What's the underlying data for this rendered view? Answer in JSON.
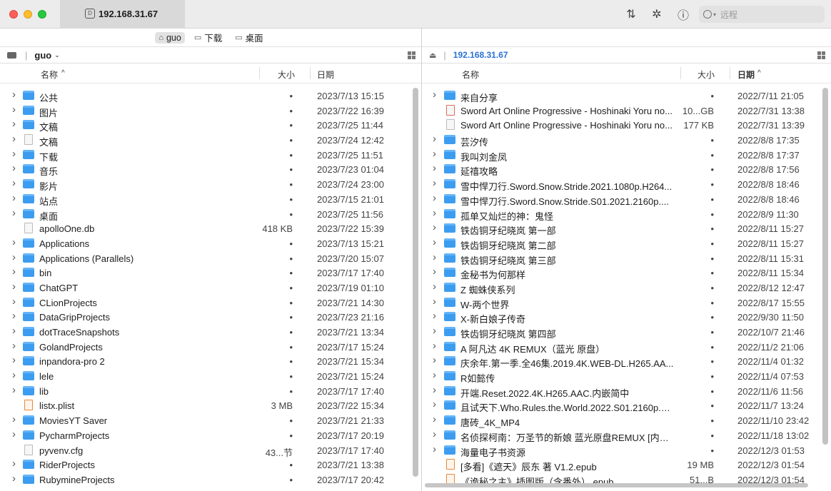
{
  "window": {
    "tab_title": "192.168.31.67"
  },
  "toolbar": {
    "sort_icon": "arrows-up-down-icon",
    "activity_icon": "pinwheel-icon",
    "info_icon": "info-icon",
    "search_placeholder": "远程"
  },
  "breadcrumbs": [
    {
      "label": "guo",
      "icon": "home-icon"
    },
    {
      "label": "下载",
      "icon": "folder-icon"
    },
    {
      "label": "桌面",
      "icon": "folder-icon"
    }
  ],
  "left": {
    "location": "guo",
    "columns": {
      "name": "名称",
      "size": "大小",
      "date": "日期"
    },
    "rows": [
      {
        "name": "公共",
        "size": "•",
        "date": "2023/7/13 15:15",
        "kind": "folder",
        "chevron": true
      },
      {
        "name": "图片",
        "size": "•",
        "date": "2023/7/22 16:39",
        "kind": "folder",
        "chevron": true
      },
      {
        "name": "文稿",
        "size": "•",
        "date": "2023/7/25 11:44",
        "kind": "folder",
        "chevron": true
      },
      {
        "name": "文稿",
        "size": "•",
        "date": "2023/7/24 12:42",
        "kind": "file",
        "chevron": true
      },
      {
        "name": "下载",
        "size": "•",
        "date": "2023/7/25 11:51",
        "kind": "folder",
        "chevron": true
      },
      {
        "name": "音乐",
        "size": "•",
        "date": "2023/7/23 01:04",
        "kind": "folder",
        "chevron": true
      },
      {
        "name": "影片",
        "size": "•",
        "date": "2023/7/24 23:00",
        "kind": "folder",
        "chevron": true
      },
      {
        "name": "站点",
        "size": "•",
        "date": "2023/7/15 21:01",
        "kind": "folder",
        "chevron": true
      },
      {
        "name": "桌面",
        "size": "•",
        "date": "2023/7/25 11:56",
        "kind": "folder",
        "chevron": true
      },
      {
        "name": "apolloOne.db",
        "size": "418 KB",
        "date": "2023/7/22 15:39",
        "kind": "file",
        "chevron": false
      },
      {
        "name": "Applications",
        "size": "•",
        "date": "2023/7/13 15:21",
        "kind": "folder",
        "chevron": true
      },
      {
        "name": "Applications (Parallels)",
        "size": "•",
        "date": "2023/7/20 15:07",
        "kind": "folder",
        "chevron": true
      },
      {
        "name": "bin",
        "size": "•",
        "date": "2023/7/17 17:40",
        "kind": "folder",
        "chevron": true
      },
      {
        "name": "ChatGPT",
        "size": "•",
        "date": "2023/7/19 01:10",
        "kind": "folder",
        "chevron": true
      },
      {
        "name": "CLionProjects",
        "size": "•",
        "date": "2023/7/21 14:30",
        "kind": "folder",
        "chevron": true
      },
      {
        "name": "DataGripProjects",
        "size": "•",
        "date": "2023/7/23 21:16",
        "kind": "folder",
        "chevron": true
      },
      {
        "name": "dotTraceSnapshots",
        "size": "•",
        "date": "2023/7/21 13:34",
        "kind": "folder",
        "chevron": true
      },
      {
        "name": "GolandProjects",
        "size": "•",
        "date": "2023/7/17 15:24",
        "kind": "folder",
        "chevron": true
      },
      {
        "name": "inpandora-pro 2",
        "size": "•",
        "date": "2023/7/21 15:34",
        "kind": "folder",
        "chevron": true
      },
      {
        "name": "lele",
        "size": "•",
        "date": "2023/7/21 15:24",
        "kind": "folder",
        "chevron": true
      },
      {
        "name": "lib",
        "size": "•",
        "date": "2023/7/17 17:40",
        "kind": "folder",
        "chevron": true
      },
      {
        "name": "listx.plist",
        "size": "3 MB",
        "date": "2023/7/22 15:34",
        "kind": "file-orange",
        "chevron": false
      },
      {
        "name": "MoviesYT Saver",
        "size": "•",
        "date": "2023/7/21 21:33",
        "kind": "folder",
        "chevron": true
      },
      {
        "name": "PycharmProjects",
        "size": "•",
        "date": "2023/7/17 20:19",
        "kind": "folder",
        "chevron": true
      },
      {
        "name": "pyvenv.cfg",
        "size": "43...节",
        "date": "2023/7/17 17:40",
        "kind": "file",
        "chevron": false
      },
      {
        "name": "RiderProjects",
        "size": "•",
        "date": "2023/7/21 13:38",
        "kind": "folder",
        "chevron": true
      },
      {
        "name": "RubymineProjects",
        "size": "•",
        "date": "2023/7/17 20:42",
        "kind": "folder",
        "chevron": true
      }
    ]
  },
  "right": {
    "location": "192.168.31.67",
    "columns": {
      "name": "名称",
      "size": "大小",
      "date": "日期"
    },
    "rows": [
      {
        "name": "来自分享",
        "size": "•",
        "date": "2022/7/11 21:05",
        "kind": "folder",
        "chevron": true
      },
      {
        "name": "Sword Art Online Progressive - Hoshinaki Yoru no...",
        "size": "10...GB",
        "date": "2022/7/31 13:38",
        "kind": "file-red",
        "chevron": false
      },
      {
        "name": "Sword Art Online Progressive - Hoshinaki Yoru no...",
        "size": "177 KB",
        "date": "2022/7/31 13:39",
        "kind": "file",
        "chevron": false
      },
      {
        "name": "芸汐传",
        "size": "•",
        "date": "2022/8/8 17:35",
        "kind": "folder",
        "chevron": true
      },
      {
        "name": "我叫刘金凤",
        "size": "•",
        "date": "2022/8/8 17:37",
        "kind": "folder",
        "chevron": true
      },
      {
        "name": "延禧攻略",
        "size": "•",
        "date": "2022/8/8 17:56",
        "kind": "folder",
        "chevron": true
      },
      {
        "name": "雪中悍刀行.Sword.Snow.Stride.2021.1080p.H264...",
        "size": "•",
        "date": "2022/8/8 18:46",
        "kind": "folder",
        "chevron": true
      },
      {
        "name": "雪中悍刀行.Sword.Snow.Stride.S01.2021.2160p....",
        "size": "•",
        "date": "2022/8/8 18:46",
        "kind": "folder",
        "chevron": true
      },
      {
        "name": "孤单又灿烂的神：鬼怪",
        "size": "•",
        "date": "2022/8/9 11:30",
        "kind": "folder",
        "chevron": true
      },
      {
        "name": "铁齿铜牙纪晓岚 第一部",
        "size": "•",
        "date": "2022/8/11 15:27",
        "kind": "folder",
        "chevron": true
      },
      {
        "name": "铁齿铜牙纪晓岚 第二部",
        "size": "•",
        "date": "2022/8/11 15:27",
        "kind": "folder",
        "chevron": true
      },
      {
        "name": "铁齿铜牙纪晓岚 第三部",
        "size": "•",
        "date": "2022/8/11 15:31",
        "kind": "folder",
        "chevron": true
      },
      {
        "name": "金秘书为何那样",
        "size": "•",
        "date": "2022/8/11 15:34",
        "kind": "folder",
        "chevron": true
      },
      {
        "name": "Z 蜘蛛侠系列",
        "size": "•",
        "date": "2022/8/12 12:47",
        "kind": "folder",
        "chevron": true
      },
      {
        "name": "W-两个世界",
        "size": "•",
        "date": "2022/8/17 15:55",
        "kind": "folder",
        "chevron": true
      },
      {
        "name": "X-新白娘子传奇",
        "size": "•",
        "date": "2022/9/30 11:50",
        "kind": "folder",
        "chevron": true
      },
      {
        "name": "铁齿铜牙纪晓岚 第四部",
        "size": "•",
        "date": "2022/10/7 21:46",
        "kind": "folder",
        "chevron": true
      },
      {
        "name": "A 阿凡达 4K REMUX（蓝光 原盘）",
        "size": "•",
        "date": "2022/11/2 21:06",
        "kind": "folder",
        "chevron": true
      },
      {
        "name": "庆余年.第一季.全46集.2019.4K.WEB-DL.H265.AA...",
        "size": "•",
        "date": "2022/11/4 01:32",
        "kind": "folder",
        "chevron": true
      },
      {
        "name": "R如懿传",
        "size": "•",
        "date": "2022/11/4 07:53",
        "kind": "folder",
        "chevron": true
      },
      {
        "name": "开端.Reset.2022.4K.H265.AAC.内嵌简中",
        "size": "•",
        "date": "2022/11/6 11:56",
        "kind": "folder",
        "chevron": true
      },
      {
        "name": "且试天下.Who.Rules.the.World.2022.S01.2160p.W...",
        "size": "•",
        "date": "2022/11/7 13:24",
        "kind": "folder",
        "chevron": true
      },
      {
        "name": "唐砖_4K_MP4",
        "size": "•",
        "date": "2022/11/10 23:42",
        "kind": "folder",
        "chevron": true
      },
      {
        "name": "名侦探柯南：万圣节的新娘 蓝光原盘REMUX [内封...",
        "size": "•",
        "date": "2022/11/18 13:02",
        "kind": "folder",
        "chevron": true
      },
      {
        "name": "海量电子书资源",
        "size": "•",
        "date": "2022/12/3 01:53",
        "kind": "folder",
        "chevron": true
      },
      {
        "name": "[多看]《遮天》辰东 著 V1.2.epub",
        "size": "19 MB",
        "date": "2022/12/3 01:54",
        "kind": "file-orange",
        "chevron": false
      },
      {
        "name": "《诡秘之主》插图版（含番外）.epub",
        "size": "51...B",
        "date": "2022/12/3 01:54",
        "kind": "file-orange",
        "chevron": false
      }
    ]
  }
}
